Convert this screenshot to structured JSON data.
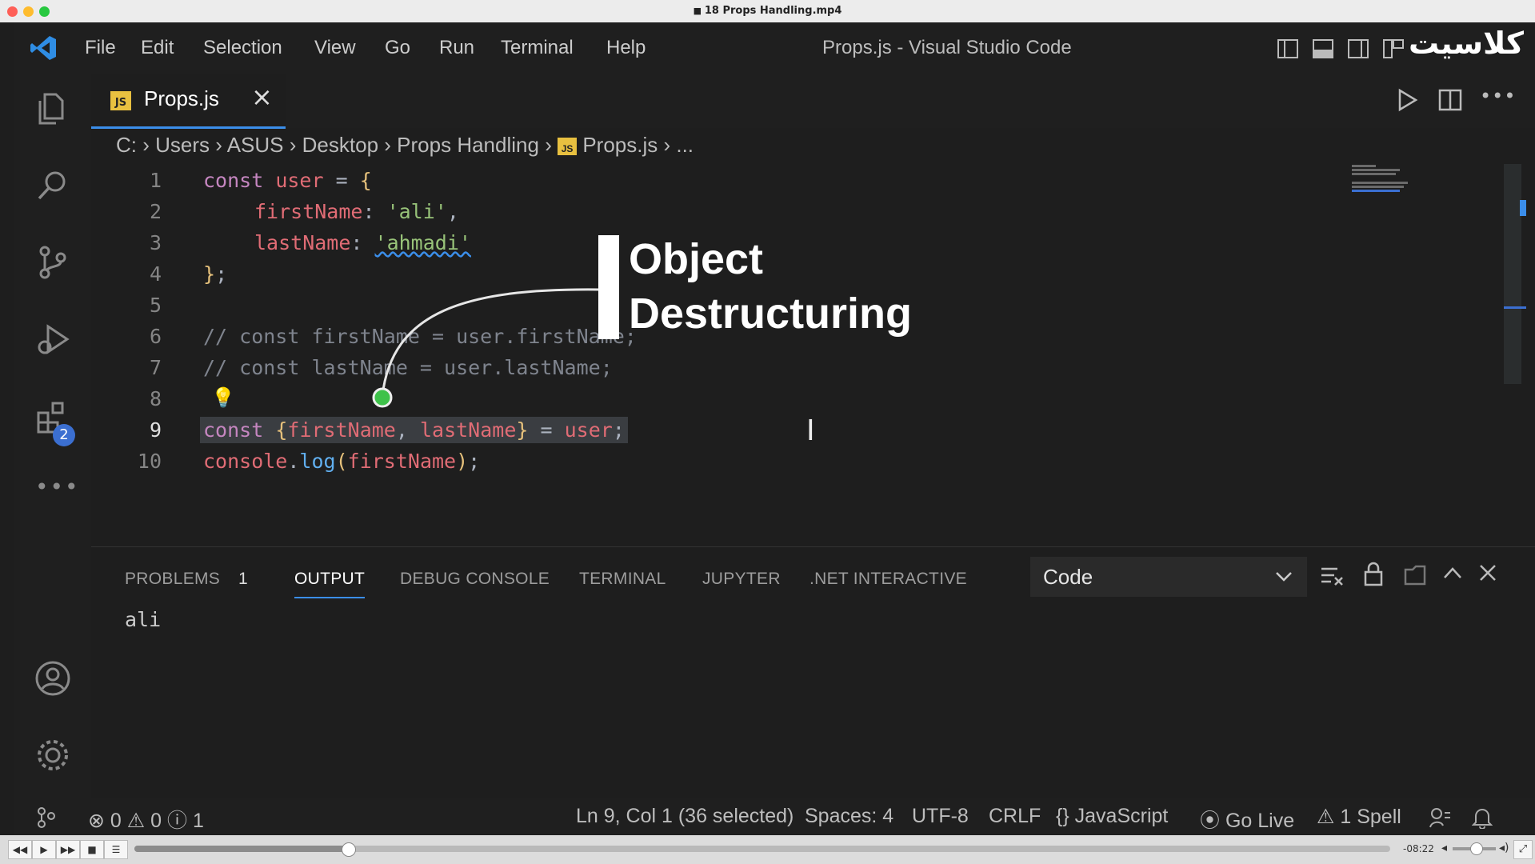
{
  "mac": {
    "title": "18 Props Handling.mp4"
  },
  "menu": [
    "File",
    "Edit",
    "Selection",
    "View",
    "Go",
    "Run",
    "Terminal",
    "Help"
  ],
  "window_title": "Props.js - Visual Studio Code",
  "logo_text": "کلاسیت",
  "activity": {
    "extensions_badge": "2"
  },
  "tab": {
    "icon": "JS",
    "label": "Props.js"
  },
  "breadcrumb": {
    "c": "C:",
    "users": "Users",
    "asus": "ASUS",
    "desktop": "Desktop",
    "folder": "Props Handling",
    "icon": "JS",
    "file": "Props.js",
    "more": "..."
  },
  "code": {
    "line_numbers": [
      "1",
      "2",
      "3",
      "4",
      "5",
      "6",
      "7",
      "8",
      "9",
      "10"
    ],
    "l1": {
      "kw": "const",
      "var": "user",
      "op": " = ",
      "brace": "{"
    },
    "l2": {
      "prop": "firstName",
      "colon": ": ",
      "str": "'ali'",
      "comma": ","
    },
    "l3": {
      "prop": "lastName",
      "colon": ": ",
      "str": "'ahmadi'"
    },
    "l4": {
      "brace": "}",
      "semi": ";"
    },
    "l6": "// const firstName = user.firstName;",
    "l7": "// const lastName = user.lastName;",
    "l9": {
      "kw": "const",
      "open": "{",
      "a": "firstName",
      "sep": ", ",
      "b": "lastName",
      "close": "}",
      "eq": " = ",
      "obj": "user",
      "semi": ";"
    },
    "l10": {
      "obj": "console",
      "dot": ".",
      "fn": "log",
      "open": "(",
      "arg": "firstName",
      "close": ")",
      "semi": ";"
    }
  },
  "annotation": {
    "line1": "Object",
    "line2": "Destructuring"
  },
  "panel": {
    "tabs": [
      "PROBLEMS",
      "OUTPUT",
      "DEBUG CONSOLE",
      "TERMINAL",
      "JUPYTER",
      ".NET INTERACTIVE"
    ],
    "problems_count": "1",
    "dropdown": "Code",
    "output": "ali"
  },
  "status": {
    "errors": "0",
    "warnings": "0",
    "info": "1",
    "position": "Ln 9, Col 1 (36 selected)",
    "spaces": "Spaces: 4",
    "encoding": "UTF-8",
    "eol": "CRLF",
    "language": "JavaScript",
    "golive": "Go Live",
    "spell": "1 Spell"
  },
  "video": {
    "time": "-08:22",
    "progress": 0.17
  },
  "colors": {
    "accent": "#3b8eea",
    "selection": "#3a3d41",
    "logo": "#ffffff"
  }
}
